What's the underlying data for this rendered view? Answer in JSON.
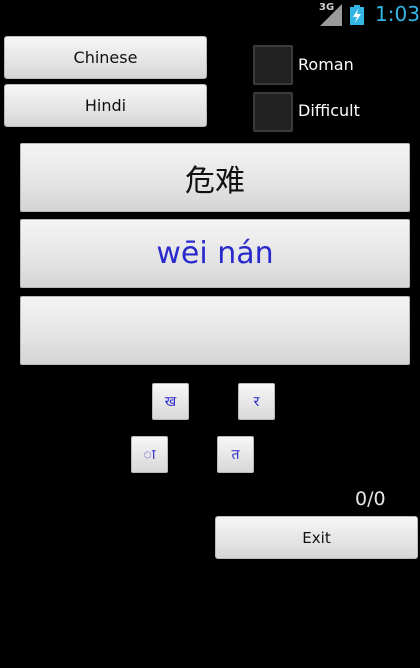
{
  "status_bar": {
    "network": "3G",
    "time": "1:03"
  },
  "buttons": {
    "chinese": "Chinese",
    "hindi": "Hindi",
    "exit": "Exit"
  },
  "options": {
    "roman": "Roman",
    "difficult": "Difficult"
  },
  "word": {
    "characters": "危难",
    "pinyin": "wēi nán",
    "answer": ""
  },
  "letters": [
    "ख",
    "र",
    "ा",
    "त"
  ],
  "score": "0/0",
  "colors": {
    "pinyin": "#2a2acc",
    "clock": "#33b5e5",
    "background": "#000000"
  }
}
